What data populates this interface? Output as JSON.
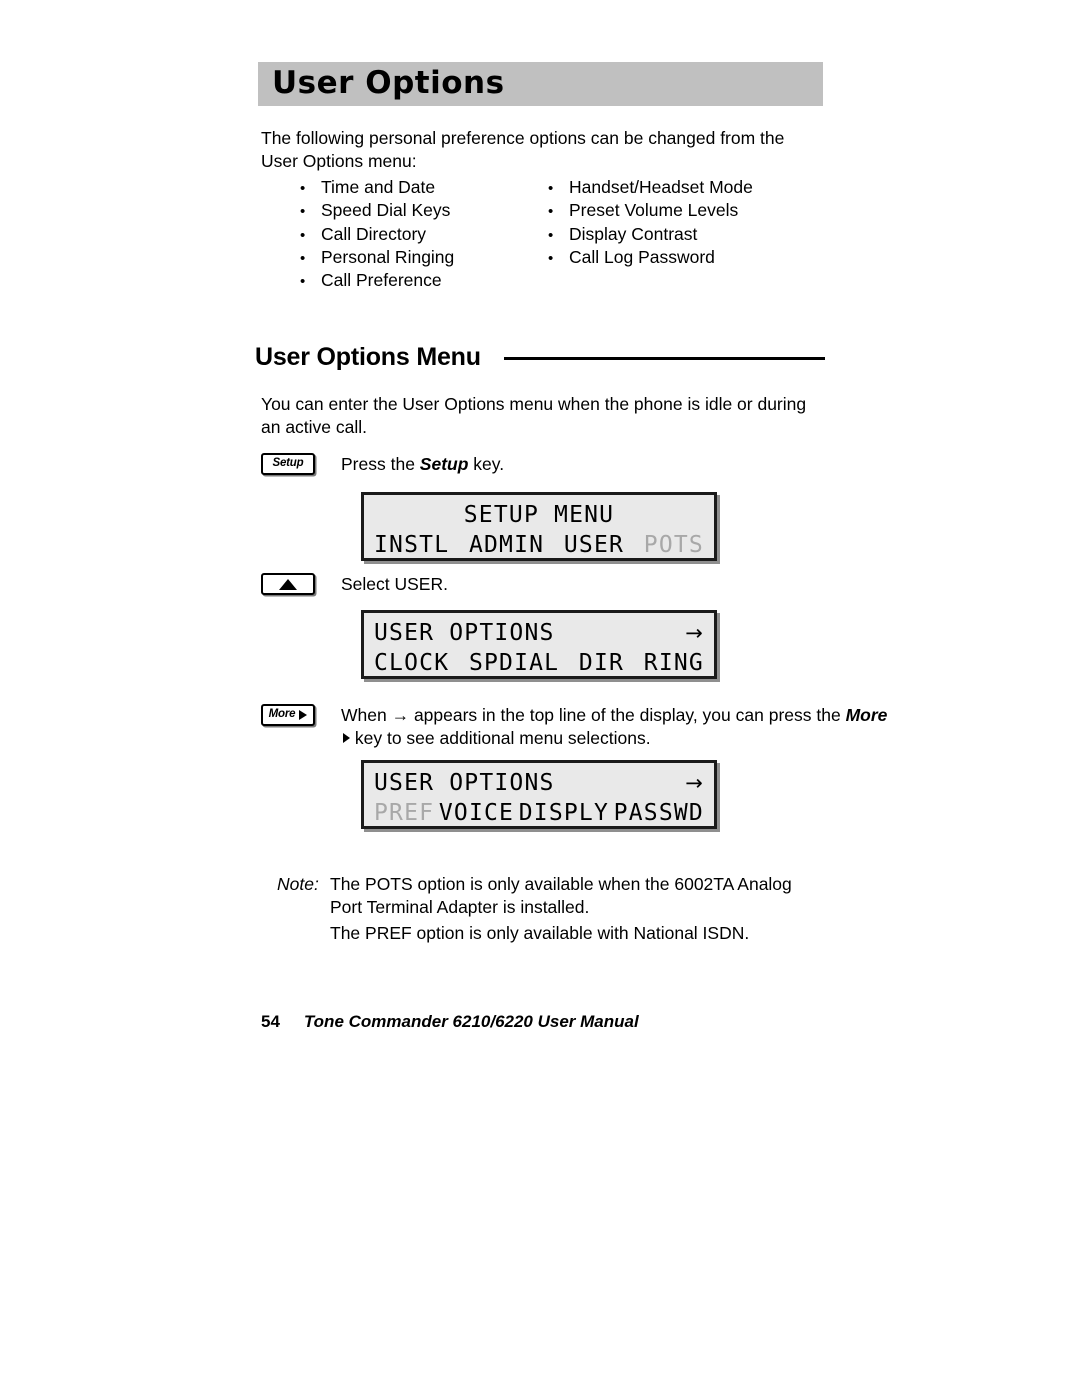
{
  "header": {
    "title": "User Options"
  },
  "intro": {
    "text": "The following personal preference options can be changed from the User Options menu:"
  },
  "option_list": {
    "bullet_glyph": "•",
    "left_column": [
      "Time and Date",
      "Speed Dial Keys",
      "Call Directory",
      "Personal Ringing",
      "Call Preference"
    ],
    "right_column": [
      "Handset/Headset Mode",
      "Preset Volume Levels",
      "Display Contrast",
      "Call Log Password"
    ]
  },
  "section": {
    "heading": "User Options Menu",
    "paragraph": "You can enter the User Options menu when the phone is idle or during an active call."
  },
  "steps": [
    {
      "key_label": "Setup",
      "instruction_before": "Press the ",
      "instruction_bold": "Setup",
      "instruction_after": " key."
    },
    {
      "key_label": "",
      "instruction_before": "Select USER.",
      "instruction_bold": "",
      "instruction_after": ""
    },
    {
      "key_label": "More",
      "instruction_before": "When → appears in the top line of the display, you can press the ",
      "instruction_bold": "More",
      "instruction_after": " key to see additional menu selections."
    }
  ],
  "displays": [
    {
      "top_line": "SETUP MENU",
      "top_arrow": "",
      "soft_keys": [
        {
          "label": "INSTL",
          "dimmed": false
        },
        {
          "label": "ADMIN",
          "dimmed": false
        },
        {
          "label": "USER",
          "dimmed": false
        },
        {
          "label": "POTS",
          "dimmed": true
        }
      ]
    },
    {
      "top_line": "USER OPTIONS",
      "top_arrow": "→",
      "soft_keys": [
        {
          "label": "CLOCK",
          "dimmed": false
        },
        {
          "label": "SPDIAL",
          "dimmed": false
        },
        {
          "label": "DIR",
          "dimmed": false
        },
        {
          "label": "RING",
          "dimmed": false
        }
      ]
    },
    {
      "top_line": "USER OPTIONS",
      "top_arrow": "→",
      "soft_keys": [
        {
          "label": "PREF",
          "dimmed": true
        },
        {
          "label": "VOICE",
          "dimmed": false
        },
        {
          "label": "DISPLY",
          "dimmed": false
        },
        {
          "label": "PASSWD",
          "dimmed": false
        }
      ]
    }
  ],
  "note": {
    "label": "Note:",
    "line1": "The POTS option is only available when the 6002TA Analog Port Terminal Adapter is installed.",
    "line2": "The PREF option is only available with National ISDN."
  },
  "footer": {
    "page_number": "54",
    "title": "Tone Commander 6210/6220 User Manual"
  },
  "colors": {
    "banner_bg": "#c0c0c0",
    "lcd_bg": "#e9e9e9",
    "lcd_border": "#1a1a1a",
    "dim_text": "#a8a8a8"
  }
}
